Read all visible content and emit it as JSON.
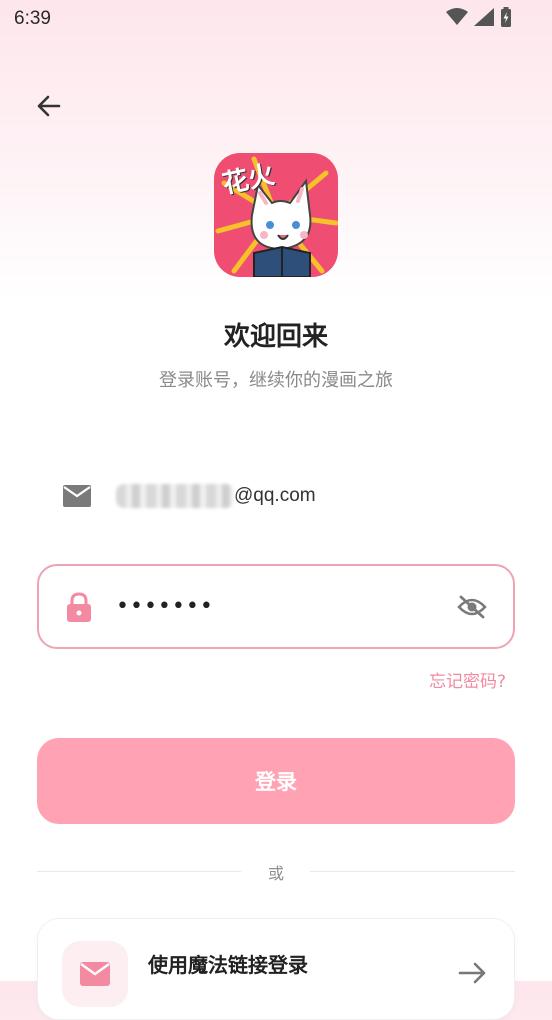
{
  "status_bar": {
    "time": "6:39",
    "icons": [
      "wifi-icon",
      "signal-icon",
      "battery-charging-icon"
    ]
  },
  "header": {
    "back_icon": "arrow-left-icon"
  },
  "logo": {
    "text": "花火",
    "colors": {
      "background": "#ef4e72",
      "accent": "#f5c22a"
    }
  },
  "welcome": {
    "title": "欢迎回来",
    "subtitle": "登录账号，继续你的漫画之旅"
  },
  "email": {
    "icon": "mail-icon",
    "value_suffix": "@qq.com"
  },
  "password": {
    "icon": "lock-icon",
    "value": "•••••••",
    "toggle_icon": "eye-off-icon"
  },
  "forgot_password": "忘记密码?",
  "login_button": "登录",
  "divider_text": "或",
  "magic_link": {
    "icon": "mail-icon",
    "label": "使用魔法链接登录",
    "arrow_icon": "arrow-right-icon"
  },
  "colors": {
    "primary": "#ffa2b3",
    "border": "#f0a3b3",
    "link": "#f08aa0"
  }
}
